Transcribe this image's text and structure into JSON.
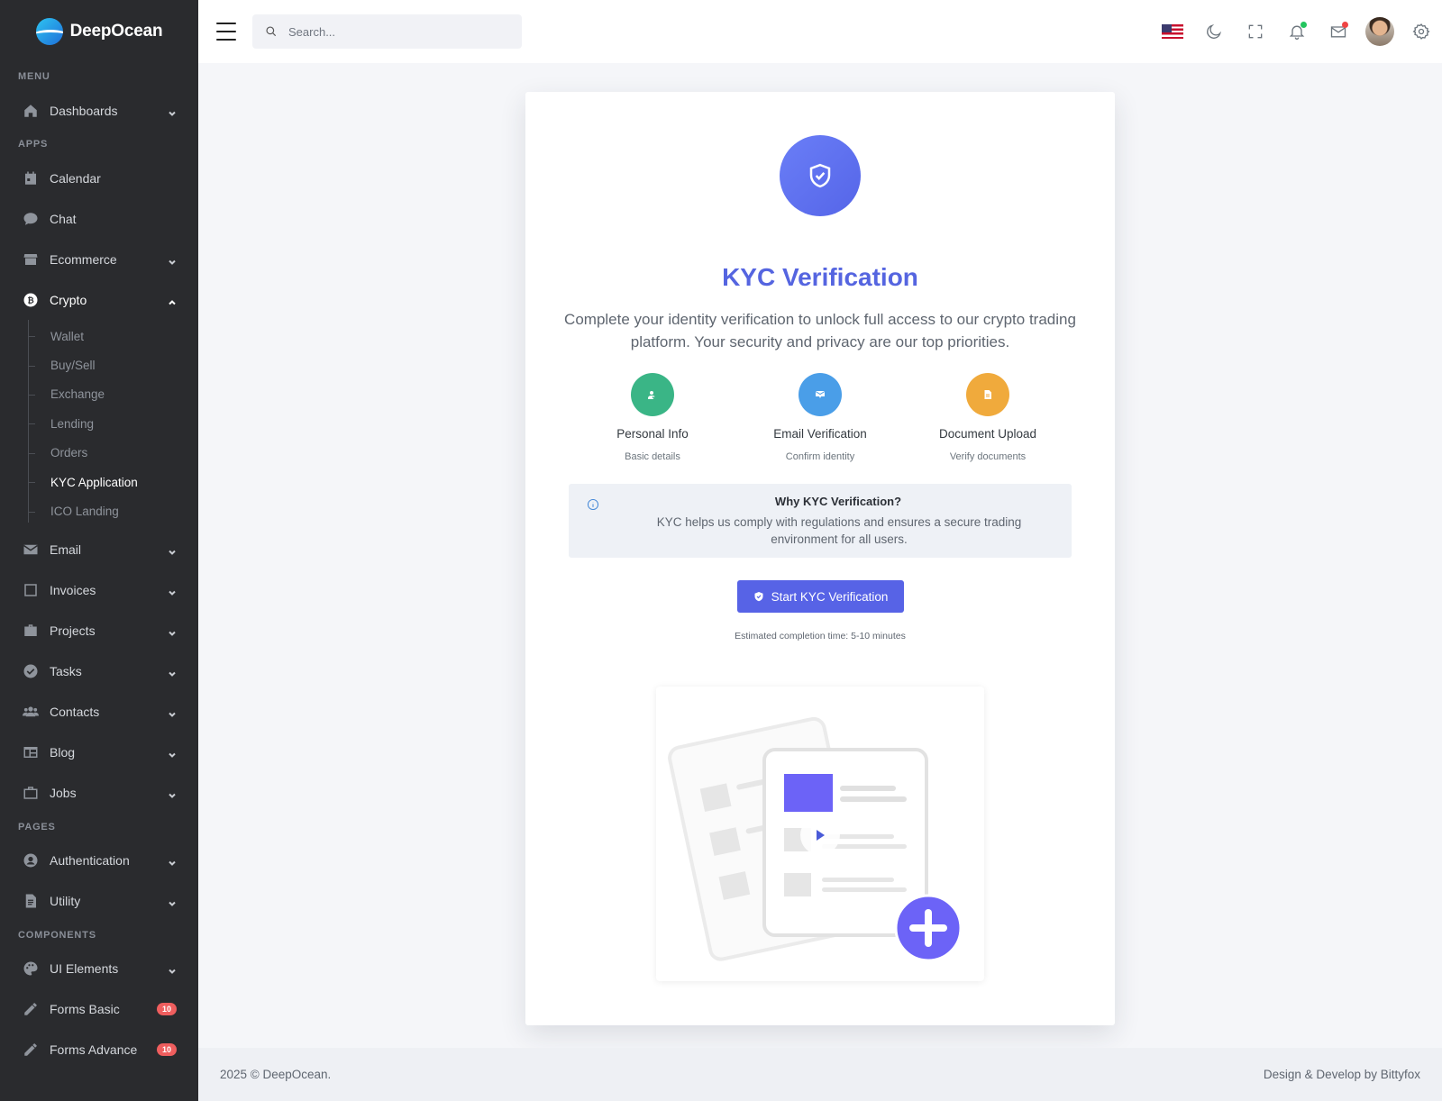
{
  "brand": {
    "name": "DeepOcean"
  },
  "sidebar": {
    "sections": {
      "menu": "MENU",
      "apps": "APPS",
      "pages": "PAGES",
      "components": "COMPONENTS"
    },
    "items": {
      "dashboards": "Dashboards",
      "calendar": "Calendar",
      "chat": "Chat",
      "ecommerce": "Ecommerce",
      "crypto": "Crypto",
      "email": "Email",
      "invoices": "Invoices",
      "projects": "Projects",
      "tasks": "Tasks",
      "contacts": "Contacts",
      "blog": "Blog",
      "jobs": "Jobs",
      "authentication": "Authentication",
      "utility": "Utility",
      "ui_elements": "UI Elements",
      "forms_basic": "Forms Basic",
      "forms_advance": "Forms Advance"
    },
    "crypto_sub": [
      "Wallet",
      "Buy/Sell",
      "Exchange",
      "Lending",
      "Orders",
      "KYC Application",
      "ICO Landing"
    ],
    "badges": {
      "forms_basic": "10",
      "forms_advance": "10"
    }
  },
  "topbar": {
    "search_placeholder": "Search...",
    "icons": [
      "menu-icon",
      "search-icon",
      "us-flag-icon",
      "moon-icon",
      "fullscreen-icon",
      "bell-icon",
      "mail-icon",
      "avatar",
      "gear-icon"
    ],
    "notification_dot_color": "#22c55e",
    "mail_dot_color": "#ef4444"
  },
  "kyc": {
    "title": "KYC Verification",
    "subtitle": "Complete your identity verification to unlock full access to our crypto trading platform. Your security and privacy are our top priorities.",
    "steps": [
      {
        "label": "Personal Info",
        "sub": "Basic details",
        "color": "#3ab586",
        "icon": "user-check-icon"
      },
      {
        "label": "Email Verification",
        "sub": "Confirm identity",
        "color": "#4a9ee8",
        "icon": "mail-check-icon"
      },
      {
        "label": "Document Upload",
        "sub": "Verify documents",
        "color": "#f0aa3c",
        "icon": "document-icon"
      }
    ],
    "why_title": "Why KYC Verification?",
    "why_text": "KYC helps us comply with regulations and ensures a secure trading environment for all users.",
    "button_label": "Start KYC Verification",
    "estimate": "Estimated completion time: 5-10 minutes",
    "accent_color": "#5565e0"
  },
  "footer": {
    "left": "2025 © DeepOcean.",
    "right": "Design & Develop by Bittyfox"
  }
}
